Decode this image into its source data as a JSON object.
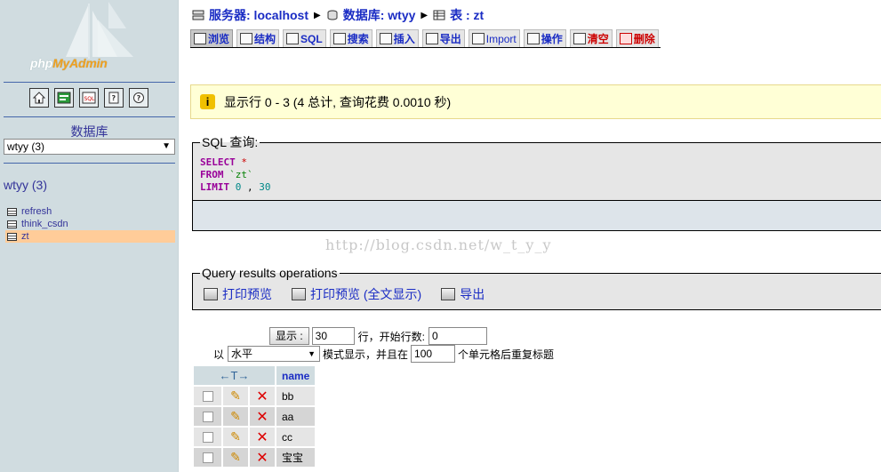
{
  "nav": {
    "logo_php": "php",
    "logo_my": "MyAdmin",
    "icons": [
      "home-icon",
      "query-window-icon",
      "sql-icon",
      "docs-icon",
      "help-icon"
    ],
    "db_label": "数据库",
    "db_selected": "wtyy (3)",
    "db_heading": "wtyy (3)",
    "tables": [
      "refresh",
      "think_csdn",
      "zt"
    ],
    "active_table": "zt"
  },
  "breadcrumb": {
    "server": "服务器: localhost",
    "database": "数据库: wtyy",
    "table": "表 : zt"
  },
  "tabs": [
    {
      "label": "浏览",
      "active": true
    },
    {
      "label": "结构"
    },
    {
      "label": "SQL"
    },
    {
      "label": "搜索"
    },
    {
      "label": "插入"
    },
    {
      "label": "导出"
    },
    {
      "label": "Import"
    },
    {
      "label": "操作"
    },
    {
      "label": "清空"
    },
    {
      "label": "删除"
    }
  ],
  "notice": "显示行 0 - 3 (4 总计, 查询花费 0.0010 秒)",
  "sql_box": {
    "legend": "SQL 查询:",
    "select": "SELECT",
    "star": "*",
    "from": "FROM",
    "table": "`zt`",
    "limit": "LIMIT",
    "offset": "0",
    "comma": ",",
    "count": "30"
  },
  "watermark": "http://blog.csdn.net/w_t_y_y",
  "query_ops": {
    "legend": "Query results operations",
    "links": [
      "打印预览",
      "打印预览 (全文显示)",
      "导出"
    ]
  },
  "nav_form": {
    "show_button": "显示 :",
    "rows_value": "30",
    "rows_label": "行，开始行数:",
    "start_value": "0",
    "mode_prefix": "以",
    "mode_value": "水平",
    "mode_label": "模式显示，并且在",
    "repeat_value": "100",
    "repeat_label": "个单元格后重复标题"
  },
  "results": {
    "arrows": "←T→",
    "column": "name",
    "rows": [
      "bb",
      "aa",
      "cc",
      "宝宝"
    ]
  }
}
